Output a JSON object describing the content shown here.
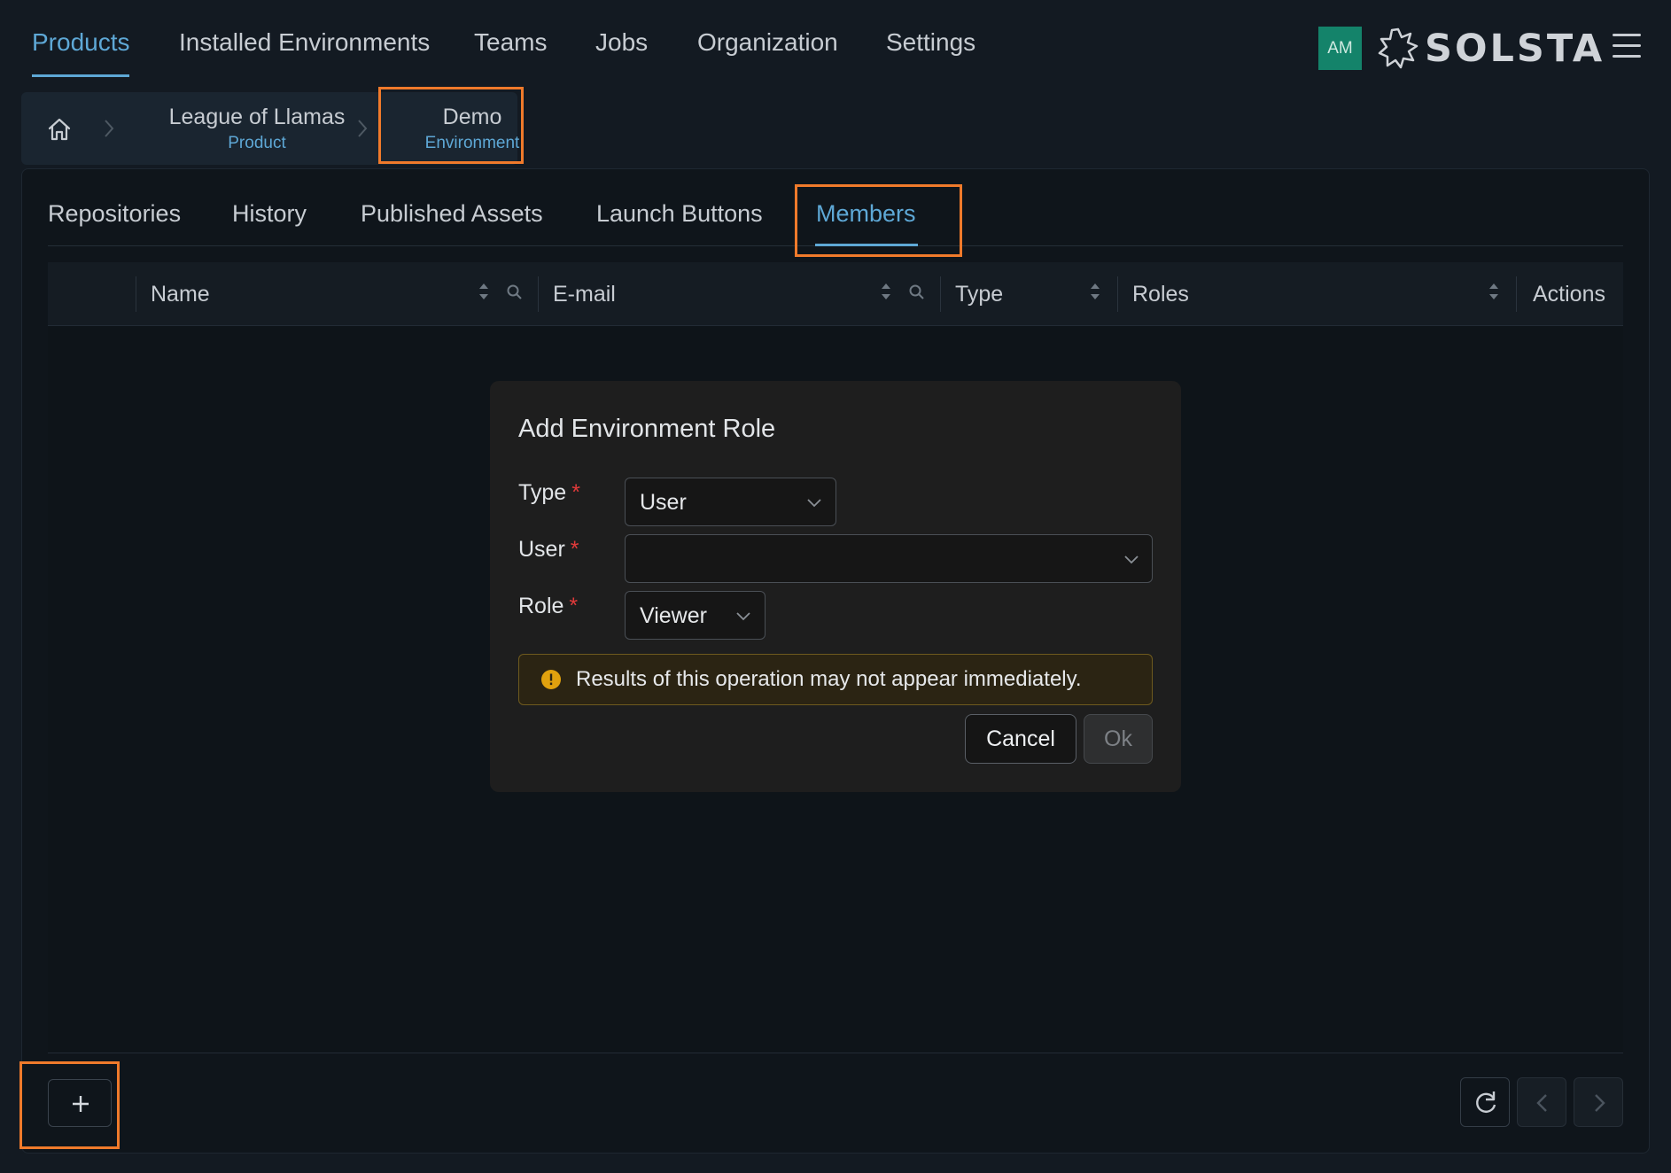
{
  "nav": {
    "items": [
      {
        "label": "Products",
        "active": true
      },
      {
        "label": "Installed Environments",
        "active": false
      },
      {
        "label": "Teams",
        "active": false
      },
      {
        "label": "Jobs",
        "active": false
      },
      {
        "label": "Organization",
        "active": false
      },
      {
        "label": "Settings",
        "active": false
      }
    ],
    "avatar_initials": "AM",
    "brand": "SOLSTA"
  },
  "breadcrumb": {
    "items": [
      {
        "name": "League of Llamas",
        "type": "Product"
      },
      {
        "name": "Demo",
        "type": "Environment"
      }
    ]
  },
  "tabs": [
    {
      "label": "Repositories",
      "active": false
    },
    {
      "label": "History",
      "active": false
    },
    {
      "label": "Published Assets",
      "active": false
    },
    {
      "label": "Launch Buttons",
      "active": false
    },
    {
      "label": "Members",
      "active": true
    }
  ],
  "table": {
    "columns": [
      "Name",
      "E-mail",
      "Type",
      "Roles",
      "Actions"
    ]
  },
  "modal": {
    "title": "Add Environment Role",
    "fields": {
      "type": {
        "label": "Type",
        "value": "User"
      },
      "user": {
        "label": "User",
        "value": ""
      },
      "role": {
        "label": "Role",
        "value": "Viewer"
      }
    },
    "required_marker": "*",
    "alert": "Results of this operation may not appear immediately.",
    "cancel_label": "Cancel",
    "ok_label": "Ok"
  },
  "colors": {
    "accent": "#5ea8d6",
    "highlight": "#f07a2b",
    "warning": "#e0a10e",
    "required": "#e03a3a",
    "avatar": "#14836a"
  }
}
